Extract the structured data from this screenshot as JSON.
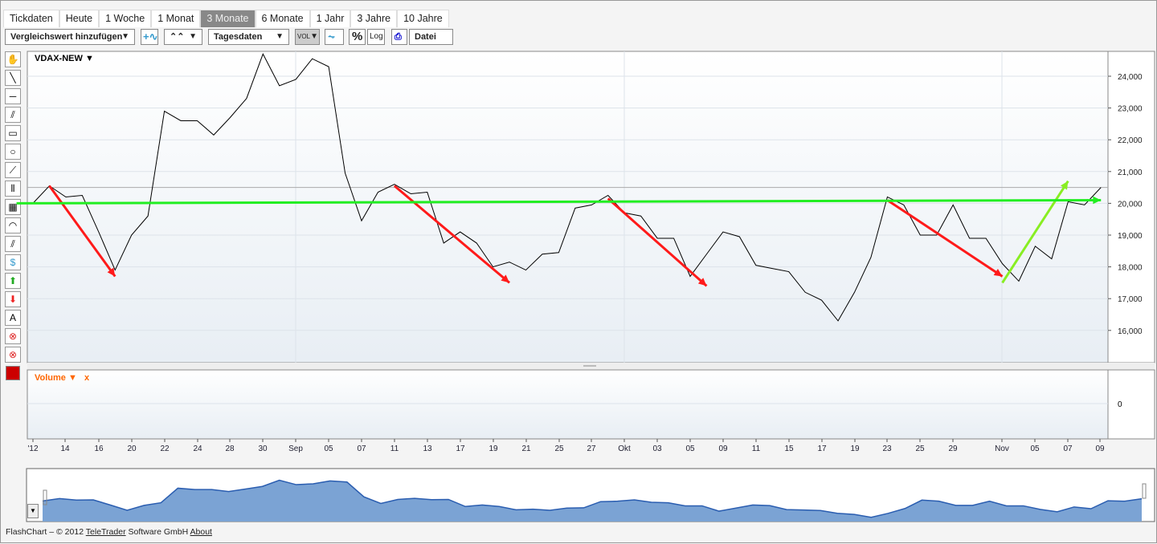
{
  "tabs": [
    "Tickdaten",
    "Heute",
    "1 Woche",
    "1 Monat",
    "3 Monate",
    "6 Monate",
    "1 Jahr",
    "3 Jahre",
    "10 Jahre"
  ],
  "active_tab": "3 Monate",
  "toolbar": {
    "compare": "Vergleichswert hinzufügen",
    "chart_type": "Tagesdaten",
    "vol": "VOL",
    "pct": "%",
    "log": "Log",
    "file": "Datei"
  },
  "tools": [
    "hand-icon",
    "line-icon",
    "horizontal-line-icon",
    "parallel-line-icon",
    "rectangle-icon",
    "circle-icon",
    "fan-icon",
    "fibonacci-icon",
    "grid-icon",
    "arc-icon",
    "channel-icon",
    "regression-icon",
    "arrow-up-icon",
    "arrow-down-icon",
    "text-icon",
    "delete-icon",
    "delete-all-icon"
  ],
  "tool_text": {
    "text": "A",
    "regression": "$"
  },
  "chart_data": {
    "type": "line",
    "title": "VDAX-NEW",
    "x_labels": [
      "'12",
      "14",
      "16",
      "20",
      "22",
      "24",
      "28",
      "30",
      "Sep",
      "05",
      "07",
      "11",
      "13",
      "17",
      "19",
      "21",
      "25",
      "27",
      "Okt",
      "03",
      "05",
      "09",
      "11",
      "15",
      "17",
      "19",
      "23",
      "25",
      "29",
      "Nov",
      "05",
      "07",
      "09"
    ],
    "y_ticks": [
      "16,000",
      "17,000",
      "18,000",
      "19,000",
      "20,000",
      "21,000",
      "22,000",
      "23,000",
      "24,000"
    ],
    "ylim": [
      15000,
      25000
    ],
    "values": [
      20000,
      20550,
      20200,
      20250,
      19100,
      17900,
      19000,
      19600,
      22900,
      22600,
      22600,
      22150,
      22700,
      23300,
      24700,
      23700,
      23900,
      24550,
      24300,
      20950,
      19450,
      20350,
      20600,
      20300,
      20350,
      18750,
      19100,
      18750,
      18000,
      18150,
      17900,
      18400,
      18450,
      19850,
      19950,
      20250,
      19700,
      19600,
      18900,
      18900,
      17700,
      18400,
      19100,
      18950,
      18050,
      17950,
      17850,
      17200,
      16950,
      16300,
      17200,
      18300,
      20200,
      19950,
      19000,
      19000,
      19950,
      18900,
      18900,
      18100,
      17550,
      18650,
      18250,
      20050,
      19950,
      20500
    ],
    "hline": 20000,
    "annotations": [
      {
        "color": "#ff1a1a",
        "from": [
          1,
          20550
        ],
        "to": [
          5,
          17700
        ]
      },
      {
        "color": "#ff1a1a",
        "from": [
          22,
          20550
        ],
        "to": [
          29,
          17500
        ]
      },
      {
        "color": "#ff1a1a",
        "from": [
          35,
          20150
        ],
        "to": [
          41,
          17400
        ]
      },
      {
        "color": "#ff1a1a",
        "from": [
          52,
          20100
        ],
        "to": [
          59,
          17700
        ]
      },
      {
        "color": "#88ee22",
        "from": [
          59,
          17500
        ],
        "to": [
          63,
          20700
        ]
      },
      {
        "color": "#22ee22",
        "from": [
          -1,
          20000
        ],
        "to": [
          65,
          20100
        ]
      }
    ],
    "volume_label": "Volume",
    "volume_close": "x",
    "volume_tick": "0"
  },
  "footer": {
    "text1": "FlashChart – © 2012 ",
    "link1": "TeleTrader",
    "text2": " Software GmbH ",
    "link2": "About"
  }
}
